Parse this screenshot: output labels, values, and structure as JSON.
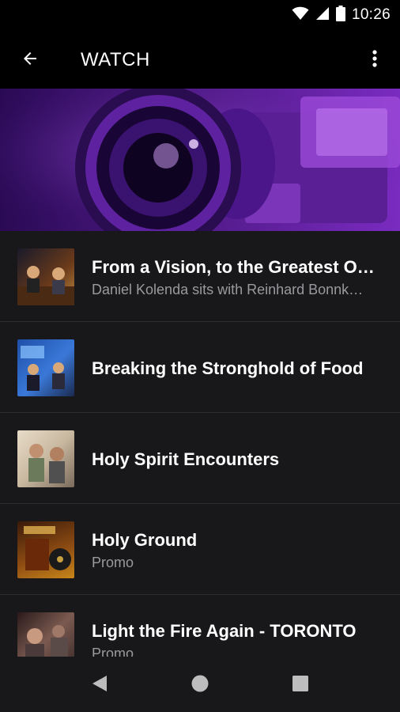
{
  "status_bar": {
    "time": "10:26",
    "icons": [
      "wifi-icon",
      "signal-icon",
      "battery-icon"
    ]
  },
  "app_bar": {
    "title": "WATCH",
    "back_icon": "arrow-left-icon",
    "menu_icon": "more-vert-icon"
  },
  "hero": {
    "image": "camera-lens-banner"
  },
  "videos": [
    {
      "title": "From a Vision, to the Greatest O…",
      "subtitle": "Daniel Kolenda sits with Reinhard Bonnk…"
    },
    {
      "title": "Breaking the Stronghold of Food",
      "subtitle": ""
    },
    {
      "title": "Holy Spirit Encounters",
      "subtitle": ""
    },
    {
      "title": "Holy Ground",
      "subtitle": "Promo"
    },
    {
      "title": "Light the Fire Again - TORONTO",
      "subtitle": "Promo"
    }
  ],
  "nav_bar": {
    "icons": [
      "back-triangle-icon",
      "home-circle-icon",
      "recents-square-icon"
    ]
  },
  "colors": {
    "background": "#18181a",
    "app_bar": "#000000",
    "accent_purple": "#8e33cc",
    "subtitle_gray": "#9a9a9e"
  }
}
